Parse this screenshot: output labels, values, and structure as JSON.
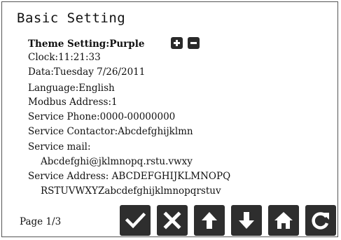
{
  "screen": {
    "title": "Basic Setting"
  },
  "theme": {
    "label": "Theme Setting:Purple",
    "add_icon": "plus-icon",
    "remove_icon": "minus-icon"
  },
  "info": {
    "clock": "Clock:11:21:33",
    "date": "Data:Tuesday  7/26/2011",
    "language": "Language:English",
    "modbus": "Modbus Address:1",
    "phone": "Service Phone:0000-00000000",
    "contactor": "Service Contactor:Abcdefghijklmn",
    "mail_label": "Service mail:",
    "mail_value": "Abcdefghi@jklmnopq.rstu.vwxy",
    "address_label": "Service Address: ABCDEFGHIJKLMNOPQ",
    "address_value": "RSTUVWXYZabcdefghijklmnopqrstuv"
  },
  "pagination": {
    "label": "Page 1/3"
  },
  "toolbar": {
    "buttons": [
      {
        "icon": "check-icon"
      },
      {
        "icon": "close-icon"
      },
      {
        "icon": "arrow-up-icon"
      },
      {
        "icon": "arrow-down-icon"
      },
      {
        "icon": "home-icon"
      },
      {
        "icon": "refresh-icon"
      }
    ]
  },
  "colors": {
    "button_bg": "#2e2e2e",
    "icon_fg": "#ffffff",
    "text": "#111111",
    "background": "#ffffff"
  }
}
